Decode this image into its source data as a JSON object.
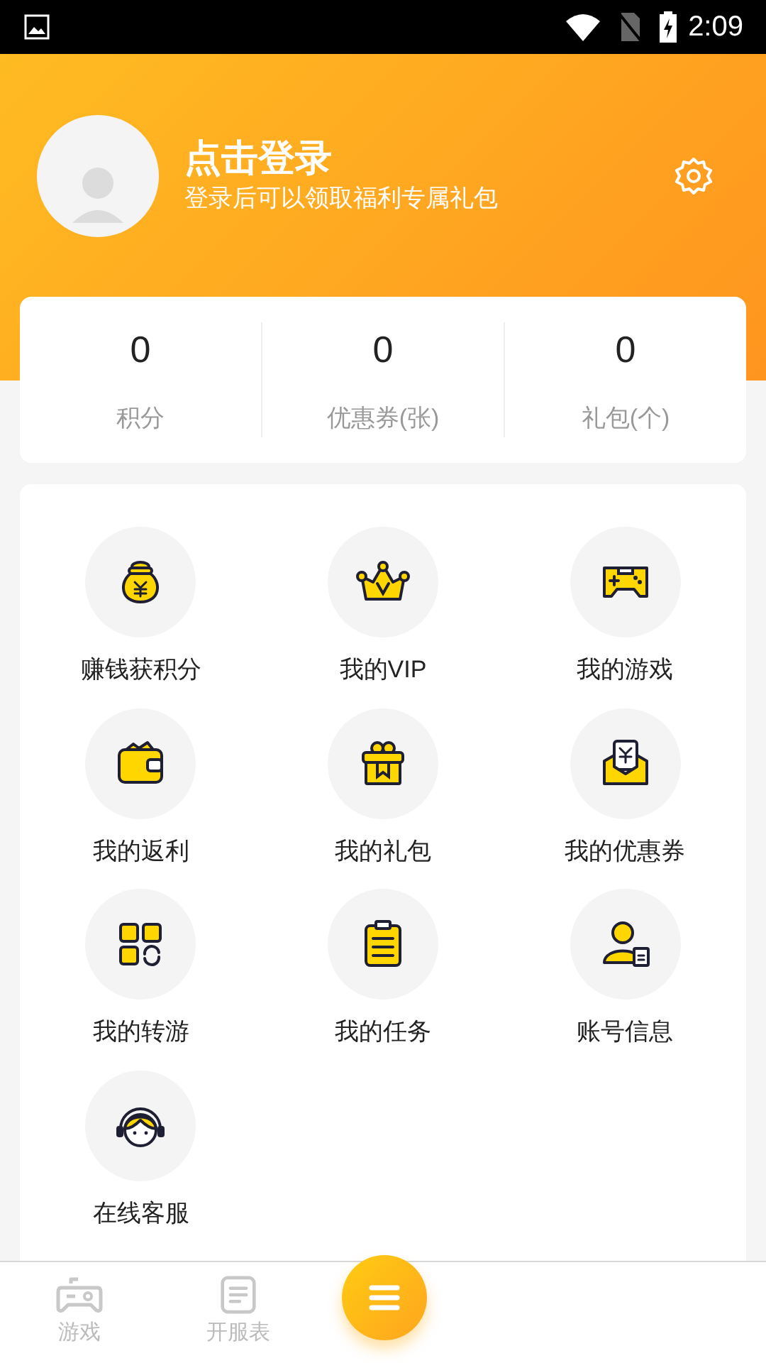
{
  "status_bar": {
    "time": "2:09"
  },
  "profile": {
    "title": "点击登录",
    "subtitle": "登录后可以领取福利专属礼包"
  },
  "stats": [
    {
      "value": "0",
      "label": "积分"
    },
    {
      "value": "0",
      "label": "优惠券(张)"
    },
    {
      "value": "0",
      "label": "礼包(个)"
    }
  ],
  "menu": [
    {
      "label": "赚钱获积分",
      "kind": "moneybag"
    },
    {
      "label": "我的VIP",
      "kind": "crown"
    },
    {
      "label": "我的游戏",
      "kind": "gamepad"
    },
    {
      "label": "我的返利",
      "kind": "wallet"
    },
    {
      "label": "我的礼包",
      "kind": "gift"
    },
    {
      "label": "我的优惠券",
      "kind": "coupon"
    },
    {
      "label": "我的转游",
      "kind": "switch"
    },
    {
      "label": "我的任务",
      "kind": "clipboard"
    },
    {
      "label": "账号信息",
      "kind": "account"
    },
    {
      "label": "在线客服",
      "kind": "support"
    }
  ],
  "bottom_nav": [
    {
      "label": "游戏",
      "kind": "gamepad",
      "selected": false
    },
    {
      "label": "开服表",
      "kind": "list",
      "selected": false
    }
  ]
}
